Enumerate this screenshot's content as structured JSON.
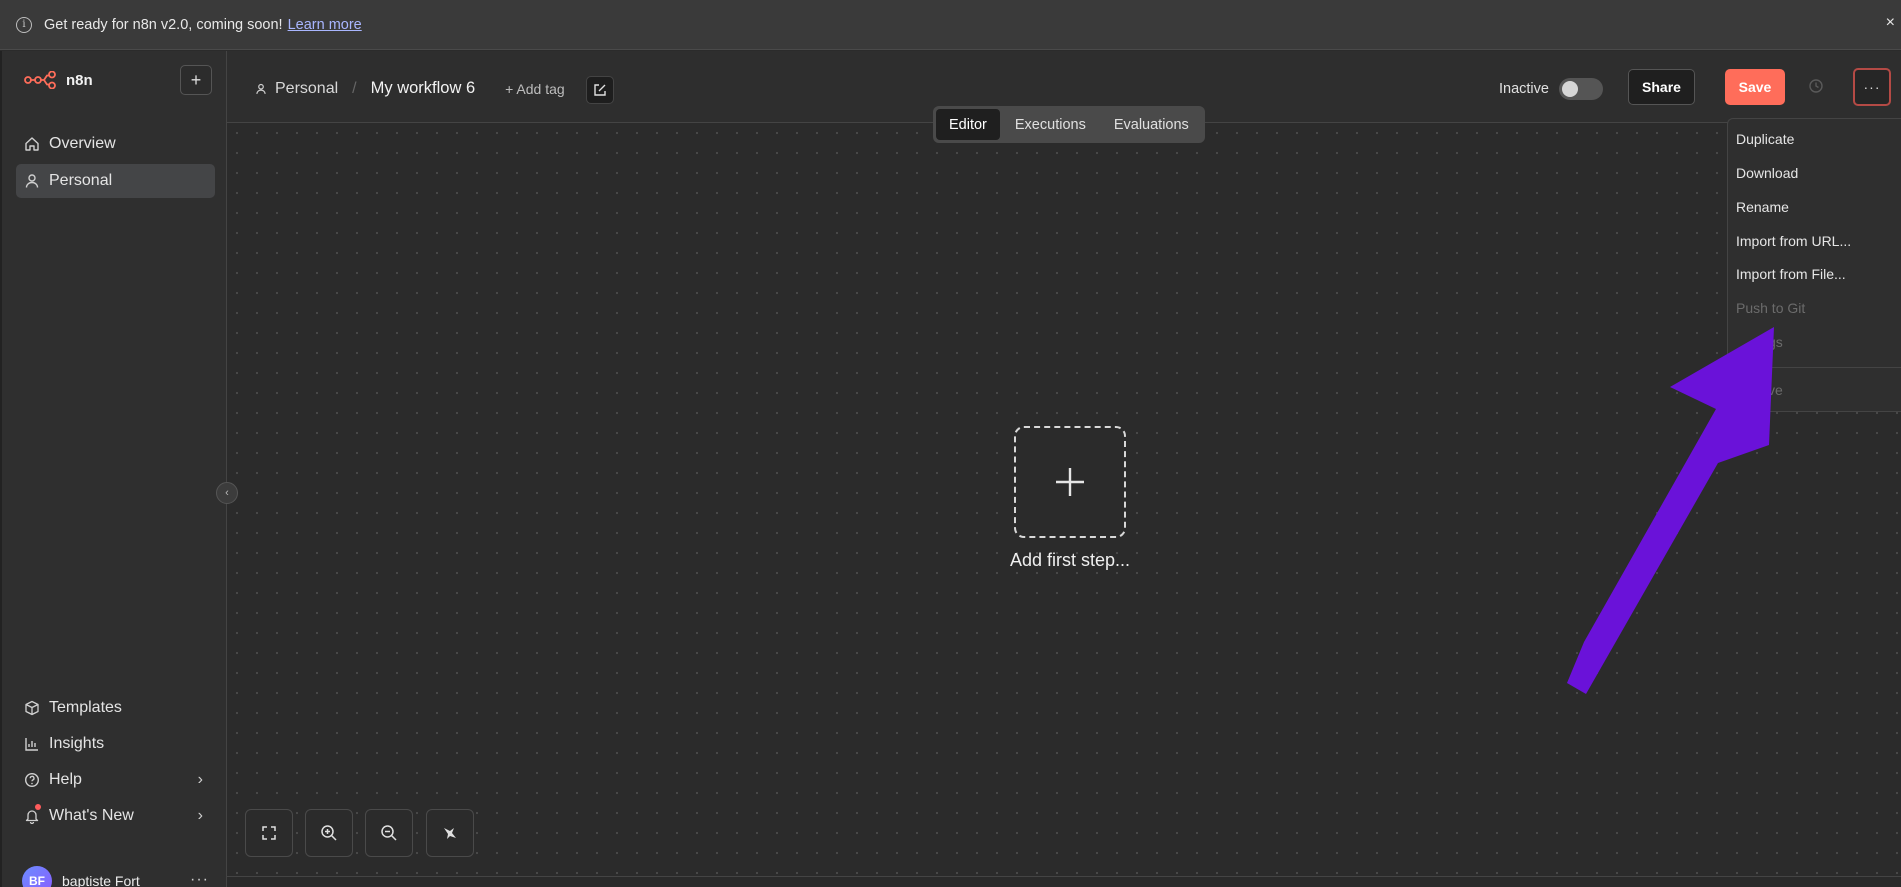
{
  "banner": {
    "message": "Get ready for n8n v2.0, coming soon!",
    "link": "Learn more",
    "close": "×"
  },
  "sidebar": {
    "brand": "n8n",
    "add": "+",
    "items": [
      {
        "label": "Overview",
        "icon": "home-icon"
      },
      {
        "label": "Personal",
        "icon": "user-icon"
      }
    ],
    "bottom_items": [
      {
        "label": "Templates",
        "icon": "box-icon"
      },
      {
        "label": "Insights",
        "icon": "chart-icon"
      },
      {
        "label": "Help",
        "icon": "help-icon"
      },
      {
        "label": "What's New",
        "icon": "bell-icon"
      }
    ],
    "user": {
      "initials": "BF",
      "name": "baptiste Fort"
    },
    "user_more": "···"
  },
  "header": {
    "project": "Personal",
    "workflow": "My workflow 6",
    "add_tag": "+ Add tag",
    "status": "Inactive",
    "share": "Share",
    "save": "Save",
    "more": "···"
  },
  "tabs": [
    "Editor",
    "Executions",
    "Evaluations"
  ],
  "canvas": {
    "add_first_step": "Add first step..."
  },
  "menu": {
    "items": [
      {
        "label": "Duplicate",
        "disabled": false
      },
      {
        "label": "Download",
        "disabled": false
      },
      {
        "label": "Rename",
        "disabled": false
      },
      {
        "label": "Import from URL...",
        "disabled": false
      },
      {
        "label": "Import from File...",
        "disabled": false
      },
      {
        "label": "Push to Git",
        "disabled": true
      },
      {
        "label": "gs",
        "disabled": true
      },
      {
        "label": "ve",
        "disabled": true
      }
    ]
  },
  "colors": {
    "accent": "#ff6d5a",
    "arrow": "#6a12d9",
    "link": "#a9b6ff"
  }
}
